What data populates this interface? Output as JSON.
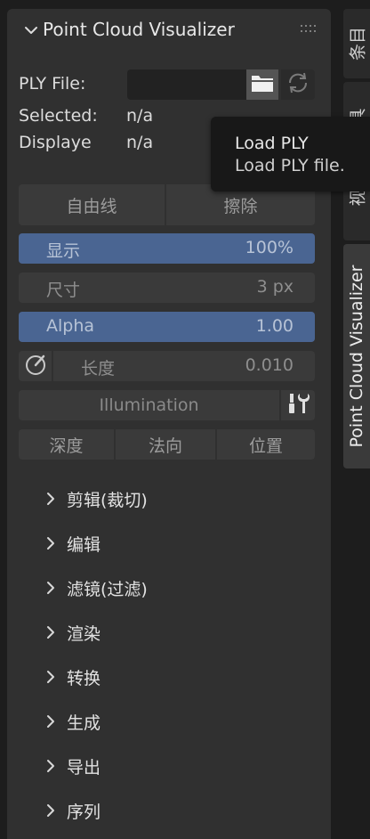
{
  "panel": {
    "title": "Point Cloud Visualizer",
    "ply_file_label": "PLY File:",
    "ply_file_value": "",
    "selected_label": "Selected:",
    "selected_value": "n/a",
    "displayed_label": "Displaye",
    "displayed_value": "n/a",
    "freehand_button": "自由线",
    "erase_button": "擦除",
    "display": {
      "label": "显示",
      "value": "100%"
    },
    "size": {
      "label": "尺寸",
      "value": "3 px"
    },
    "alpha": {
      "label": "Alpha",
      "value": "1.00"
    },
    "length": {
      "label": "长度",
      "value": "0.010"
    },
    "illumination_button": "Illumination",
    "depth_button": "深度",
    "normal_button": "法向",
    "position_button": "位置"
  },
  "sections": [
    {
      "label": "剪辑(裁切)"
    },
    {
      "label": "编辑"
    },
    {
      "label": "滤镜(过滤)"
    },
    {
      "label": "渲染"
    },
    {
      "label": "转换"
    },
    {
      "label": "生成"
    },
    {
      "label": "导出"
    },
    {
      "label": "序列"
    }
  ],
  "tabs": [
    {
      "label": "条目"
    },
    {
      "label": "具"
    },
    {
      "label": "视"
    },
    {
      "label": "Point Cloud Visualizer"
    }
  ],
  "tooltip": {
    "title": "Load PLY",
    "description": "Load PLY file."
  },
  "colors": {
    "accent_blue": "#4a6592",
    "panel_bg": "#303030",
    "button_bg": "#3a3a3a"
  }
}
